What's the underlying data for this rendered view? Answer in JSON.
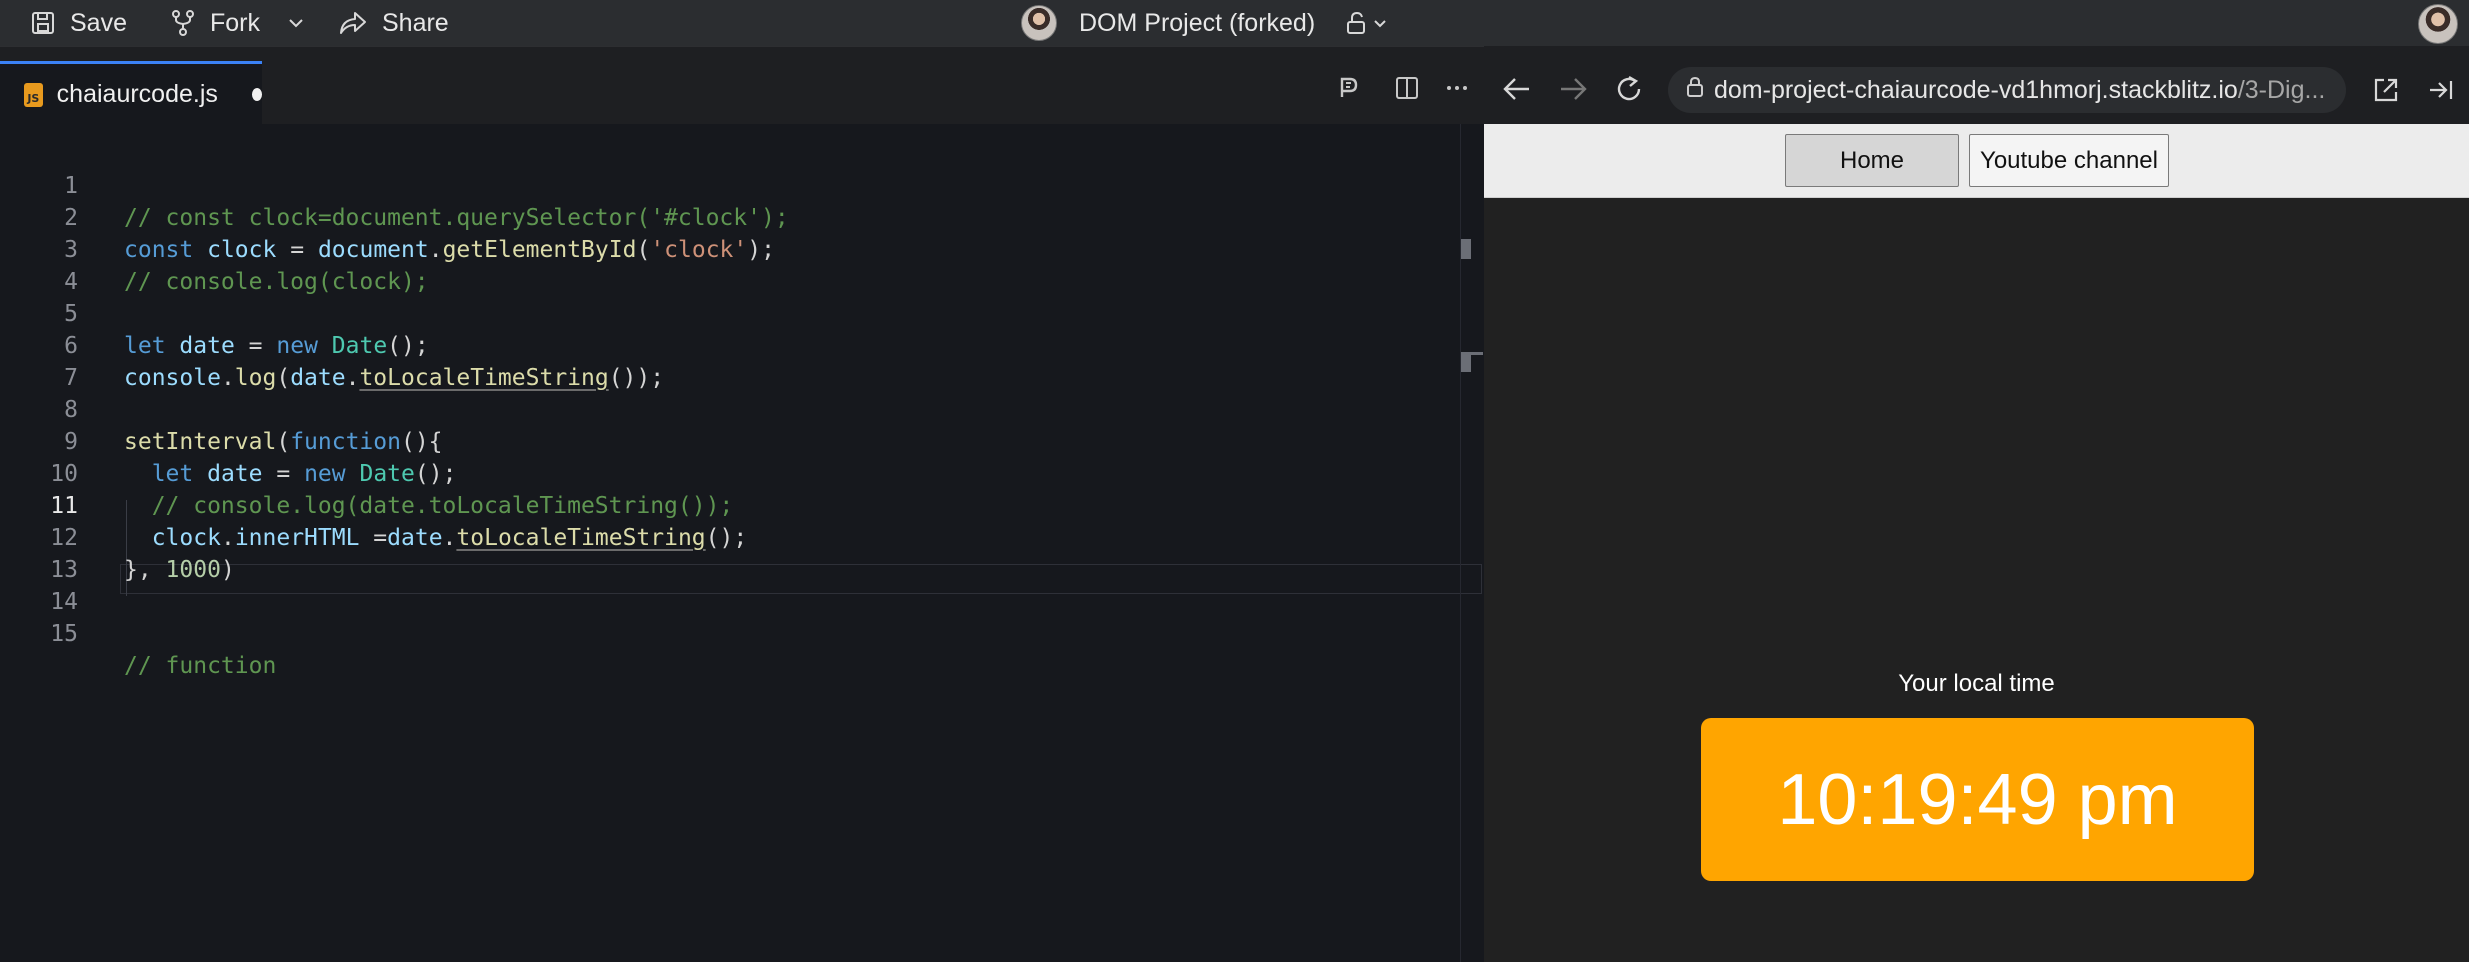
{
  "topbar": {
    "save_label": "Save",
    "fork_label": "Fork",
    "share_label": "Share",
    "project_title": "DOM Project (forked)"
  },
  "editor": {
    "file_tab": "chaiaurcode.js",
    "file_icon_text": "JS",
    "active_line": 11,
    "line_numbers": [
      "1",
      "2",
      "3",
      "4",
      "5",
      "6",
      "7",
      "8",
      "9",
      "10",
      "11",
      "12",
      "13",
      "14",
      "15"
    ]
  },
  "browser": {
    "url_main": "dom-project-chaiaurcode-vd1hmorj.stackblitz.io",
    "url_rest": "/3-Dig..."
  },
  "preview": {
    "nav_home": "Home",
    "nav_youtube": "Youtube channel",
    "local_time_label": "Your local time",
    "clock_value": "10:19:49 pm"
  },
  "colors": {
    "accent_tab": "#3b82f6",
    "clock_bg": "#ffa500",
    "editor_bg": "#16181d"
  }
}
